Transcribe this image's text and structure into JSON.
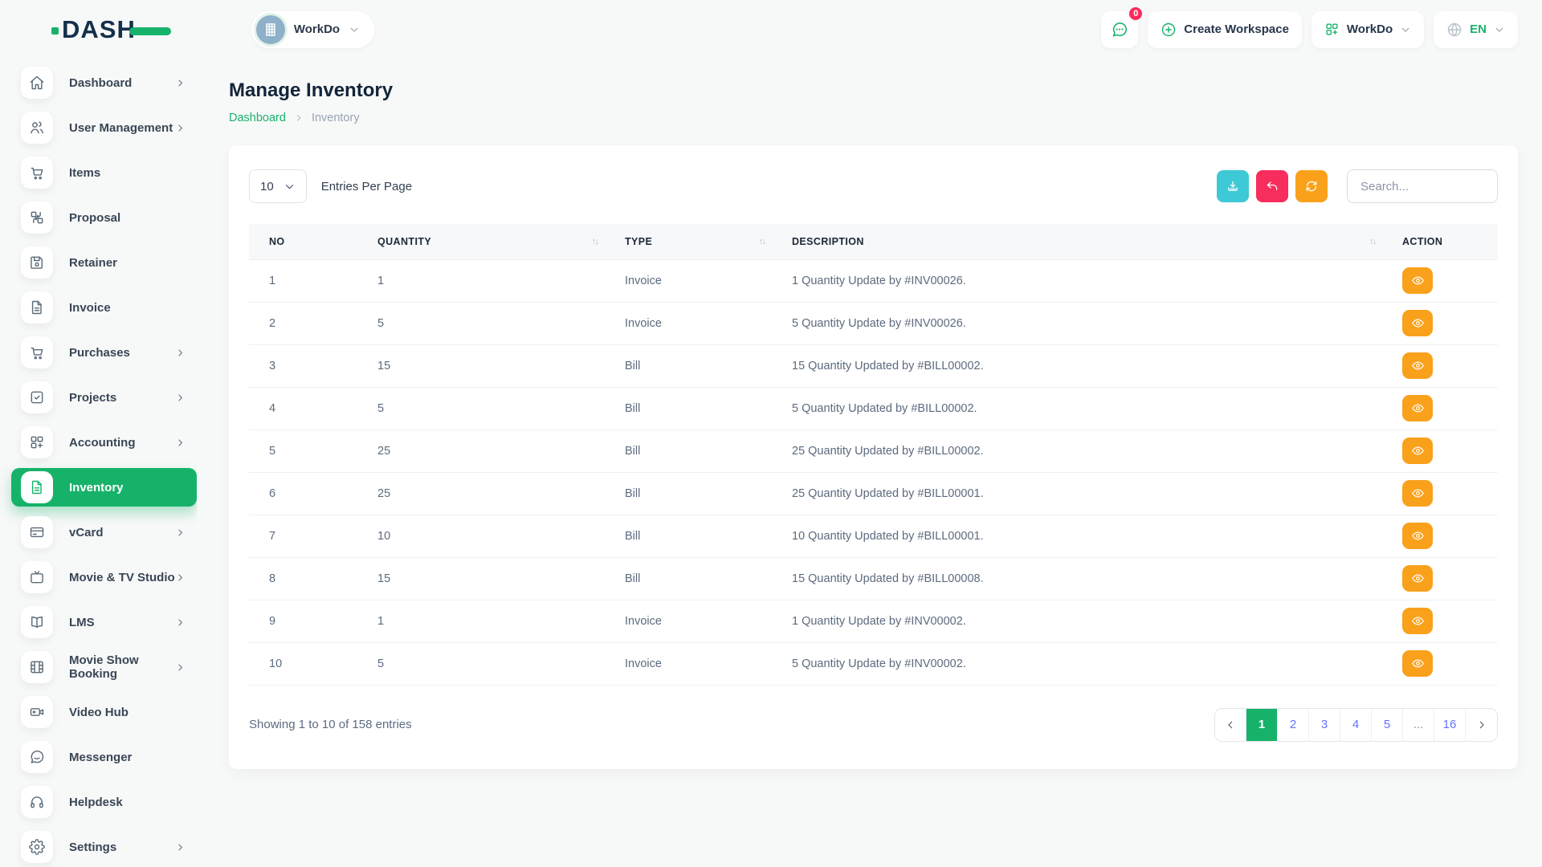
{
  "brand": {
    "logo_text": "DASH"
  },
  "topbar": {
    "workspace": {
      "name": "WorkDo",
      "avatar_icon": "building-icon"
    },
    "chat_badge": "0",
    "create_workspace_label": "Create Workspace",
    "workspace_switcher_label": "WorkDo",
    "language": "EN"
  },
  "sidebar": {
    "items": [
      {
        "label": "Dashboard",
        "icon": "home-icon",
        "chevron": true,
        "active": false
      },
      {
        "label": "User Management",
        "icon": "users-icon",
        "chevron": true,
        "active": false
      },
      {
        "label": "Items",
        "icon": "cart-icon",
        "chevron": false,
        "active": false
      },
      {
        "label": "Proposal",
        "icon": "grid-swap-icon",
        "chevron": false,
        "active": false
      },
      {
        "label": "Retainer",
        "icon": "save-icon",
        "chevron": false,
        "active": false
      },
      {
        "label": "Invoice",
        "icon": "file-icon",
        "chevron": false,
        "active": false
      },
      {
        "label": "Purchases",
        "icon": "cart-icon",
        "chevron": true,
        "active": false
      },
      {
        "label": "Projects",
        "icon": "check-square-icon",
        "chevron": true,
        "active": false
      },
      {
        "label": "Accounting",
        "icon": "grid-plus-icon",
        "chevron": true,
        "active": false
      },
      {
        "label": "Inventory",
        "icon": "file-icon",
        "chevron": false,
        "active": true
      },
      {
        "label": "vCard",
        "icon": "credit-card-icon",
        "chevron": true,
        "active": false
      },
      {
        "label": "Movie & TV Studio",
        "icon": "tv-icon",
        "chevron": true,
        "active": false
      },
      {
        "label": "LMS",
        "icon": "book-icon",
        "chevron": true,
        "active": false
      },
      {
        "label": "Movie Show Booking",
        "icon": "film-icon",
        "chevron": true,
        "active": false
      },
      {
        "label": "Video Hub",
        "icon": "video-camera-icon",
        "chevron": false,
        "active": false
      },
      {
        "label": "Messenger",
        "icon": "chat-bubble-icon",
        "chevron": false,
        "active": false
      },
      {
        "label": "Helpdesk",
        "icon": "headphones-icon",
        "chevron": false,
        "active": false
      },
      {
        "label": "Settings",
        "icon": "gear-icon",
        "chevron": true,
        "active": false
      }
    ]
  },
  "page": {
    "title": "Manage Inventory",
    "breadcrumb": [
      "Dashboard",
      "Inventory"
    ]
  },
  "controls": {
    "entries_per_page": "10",
    "entries_label": "Entries Per Page",
    "search_placeholder": "Search...",
    "buttons": [
      {
        "name": "export-button",
        "icon": "download-icon",
        "color": "#3ec9d6"
      },
      {
        "name": "undo-button",
        "icon": "undo-icon",
        "color": "#f72d5d"
      },
      {
        "name": "refresh-button",
        "icon": "refresh-icon",
        "color": "#f9a11b"
      }
    ]
  },
  "table": {
    "columns": [
      {
        "label": "NO",
        "sortable": false,
        "key": "no"
      },
      {
        "label": "QUANTITY",
        "sortable": true,
        "key": "qty"
      },
      {
        "label": "TYPE",
        "sortable": true,
        "key": "type"
      },
      {
        "label": "DESCRIPTION",
        "sortable": true,
        "key": "desc"
      },
      {
        "label": "ACTION",
        "sortable": false,
        "key": "action"
      }
    ],
    "rows": [
      {
        "no": "1",
        "qty": "1",
        "type": "Invoice",
        "desc": "1 Quantity Update by #INV00026."
      },
      {
        "no": "2",
        "qty": "5",
        "type": "Invoice",
        "desc": "5 Quantity Update by #INV00026."
      },
      {
        "no": "3",
        "qty": "15",
        "type": "Bill",
        "desc": "15 Quantity Updated by #BILL00002."
      },
      {
        "no": "4",
        "qty": "5",
        "type": "Bill",
        "desc": "5 Quantity Updated by #BILL00002."
      },
      {
        "no": "5",
        "qty": "25",
        "type": "Bill",
        "desc": "25 Quantity Updated by #BILL00002."
      },
      {
        "no": "6",
        "qty": "25",
        "type": "Bill",
        "desc": "25 Quantity Updated by #BILL00001."
      },
      {
        "no": "7",
        "qty": "10",
        "type": "Bill",
        "desc": "10 Quantity Updated by #BILL00001."
      },
      {
        "no": "8",
        "qty": "15",
        "type": "Bill",
        "desc": "15 Quantity Updated by #BILL00008."
      },
      {
        "no": "9",
        "qty": "1",
        "type": "Invoice",
        "desc": "1 Quantity Update by #INV00002."
      },
      {
        "no": "10",
        "qty": "5",
        "type": "Invoice",
        "desc": "5 Quantity Update by #INV00002."
      }
    ],
    "action_icon": "eye-icon"
  },
  "footer": {
    "summary": "Showing 1 to 10 of 158 entries",
    "pagination": {
      "pages": [
        "1",
        "2",
        "3",
        "4",
        "5",
        "...",
        "16"
      ],
      "active": "1"
    }
  },
  "colors": {
    "accent_green": "#17b26a",
    "info_cyan": "#3ec9d6",
    "danger_pink": "#f72d5d",
    "warning_orange": "#f9a11b",
    "pagination_blue": "#6571ff"
  }
}
